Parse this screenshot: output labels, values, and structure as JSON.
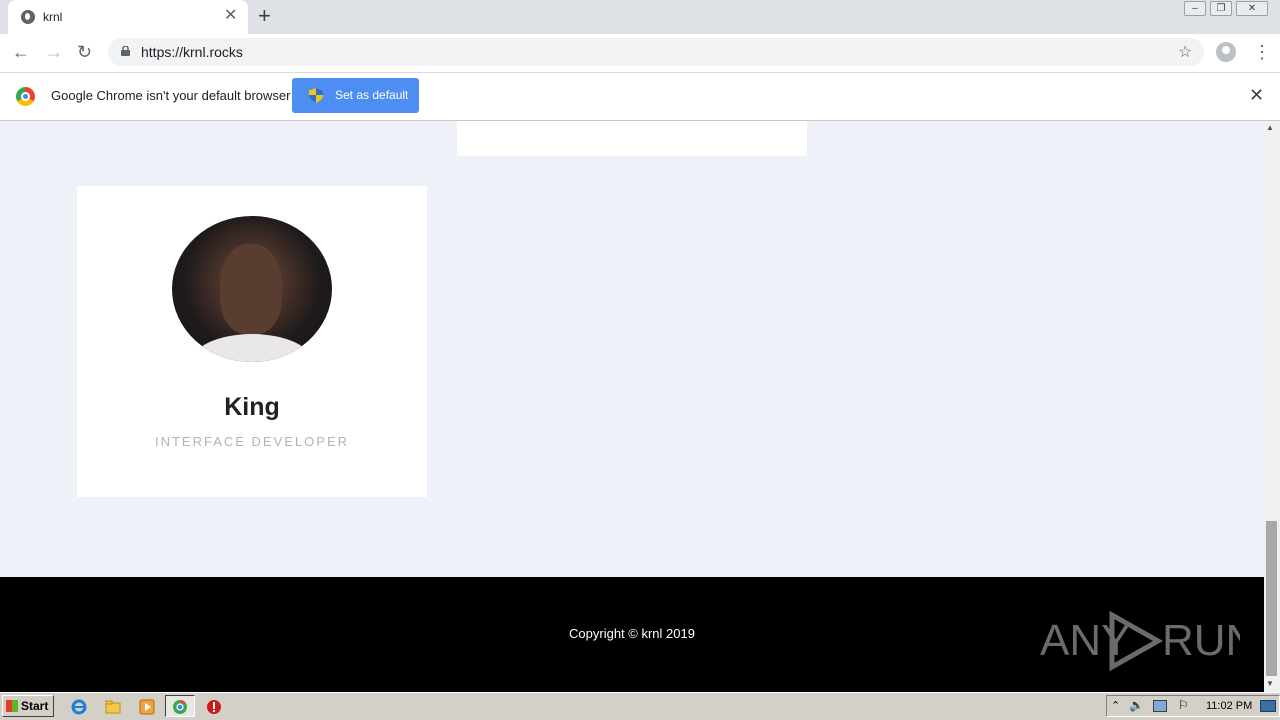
{
  "browser": {
    "tab_title": "krnl",
    "url": "https://krnl.rocks",
    "infobar_message": "Google Chrome isn't your default browser",
    "infobar_button": "Set as default"
  },
  "profile_card": {
    "name": "King",
    "role": "INTERFACE DEVELOPER"
  },
  "footer": {
    "copyright": "Copyright © krnl 2019",
    "watermark": "ANY RUN"
  },
  "taskbar": {
    "start_label": "Start",
    "clock": "11:02 PM"
  },
  "colors": {
    "page_bg": "#eef2f8",
    "footer_bg": "#000000",
    "infobar_button": "#4e8ef3"
  }
}
